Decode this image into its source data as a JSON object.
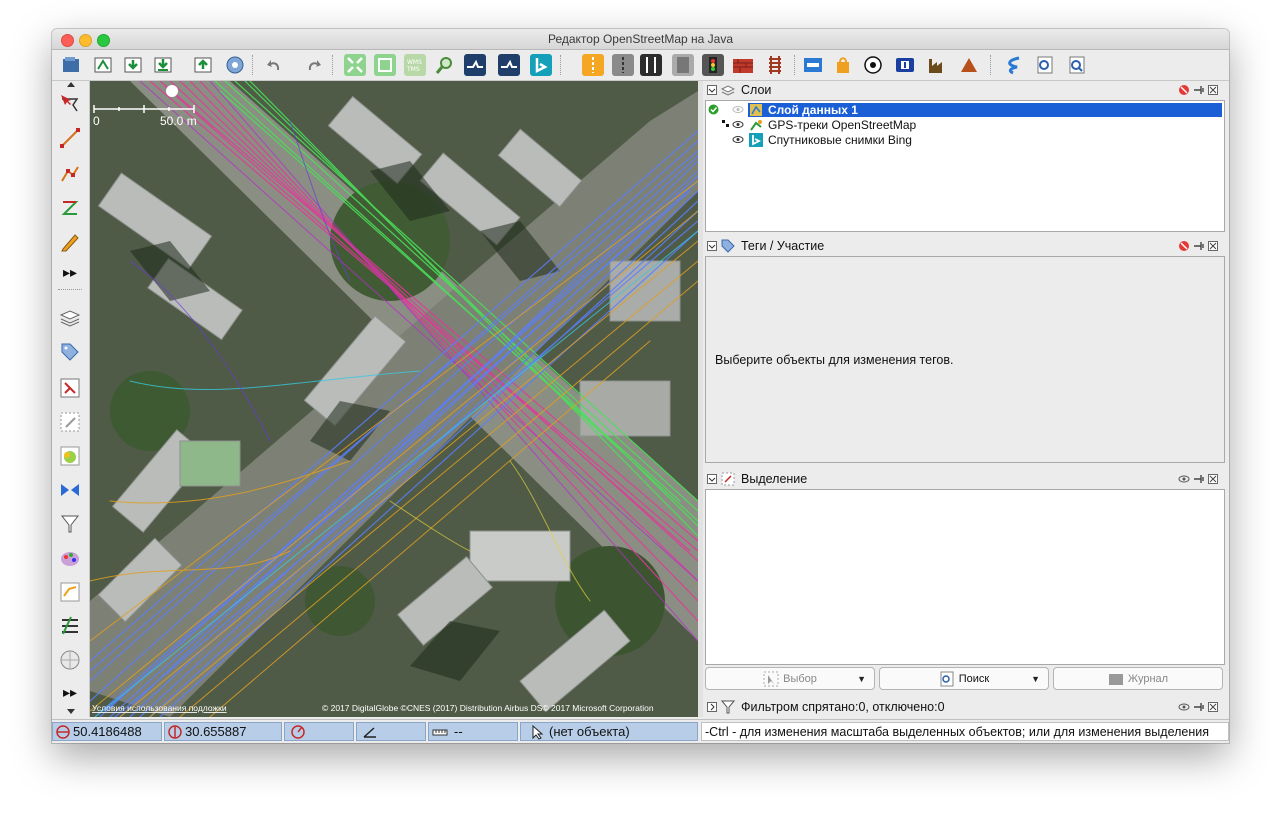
{
  "window": {
    "title": "Редактор OpenStreetMap на Java"
  },
  "colors": {
    "selection": "#1a5fd6",
    "status_field": "#b7cde8",
    "gps_pink": "#e2389a",
    "gps_green": "#4ae05a",
    "gps_blue": "#5a7fff",
    "gps_orange": "#e0a020"
  },
  "toolbar": {
    "icons": [
      "open-file-icon",
      "open-location-icon",
      "download-icon",
      "download-object-icon",
      "upload-icon",
      "preferences-icon",
      "undo-icon",
      "redo-icon",
      "zoom-to-data-icon",
      "zoom-to-selection-icon",
      "wms-imagery-icon",
      "zoom-icon",
      "osm-layer-icon",
      "gps-layer-icon",
      "bing-icon",
      "road-preset-icon",
      "track-preset-icon",
      "rail-preset-icon",
      "bridge-preset-icon",
      "traffic-light-preset-icon",
      "wall-preset-icon",
      "railway-preset-icon",
      "bed-preset-icon",
      "shop-preset-icon",
      "football-preset-icon",
      "information-preset-icon",
      "industrial-preset-icon",
      "peak-preset-icon",
      "river-preset-icon",
      "search-preset-icon",
      "search-object-icon"
    ]
  },
  "left_toolbar": {
    "icons": [
      "select-mode-icon",
      "draw-line-icon",
      "improve-way-icon",
      "parallel-way-icon",
      "pencil-icon",
      "more-tools-icon",
      "layers-icon",
      "tags-icon",
      "relations-icon",
      "selection-list-icon",
      "conflicts-icon",
      "validation-icon",
      "filter-icon",
      "map-paint-icon",
      "changesets-icon",
      "todo-icon",
      "globe-icon",
      "more-panels-icon"
    ]
  },
  "map": {
    "scale_zero": "0",
    "scale_label": "50.0 m",
    "terms_link": "Условия использования подложки",
    "attribution": "© 2017 DigitalGlobe ©CNES (2017) Distribution Airbus DS© 2017 Microsoft Corporation"
  },
  "layers_panel": {
    "title": "Слои",
    "items": [
      {
        "name": "Слой данных 1",
        "selected": true,
        "icon": "data-layer-icon"
      },
      {
        "name": "GPS-треки OpenStreetMap",
        "selected": false,
        "icon": "gps-layer-icon"
      },
      {
        "name": "Спутниковые снимки Bing",
        "selected": false,
        "icon": "bing-icon"
      }
    ]
  },
  "tags_panel": {
    "title": "Теги / Участие",
    "empty_message": "Выберите объекты для изменения тегов."
  },
  "selection_panel": {
    "title": "Выделение",
    "buttons": [
      {
        "label": "Выбор",
        "enabled": false
      },
      {
        "label": "Поиск",
        "enabled": true
      },
      {
        "label": "Журнал",
        "enabled": false
      }
    ]
  },
  "filter_panel": {
    "title": "Фильтром спрятано:0, отключено:0"
  },
  "statusbar": {
    "lat": "50.4186488",
    "lon": "30.655887",
    "heading": "",
    "angle": "",
    "distance": "--",
    "object": "(нет объекта)",
    "hint": "-Ctrl - для изменения масштаба выделенных объектов; или для изменения выделения"
  }
}
